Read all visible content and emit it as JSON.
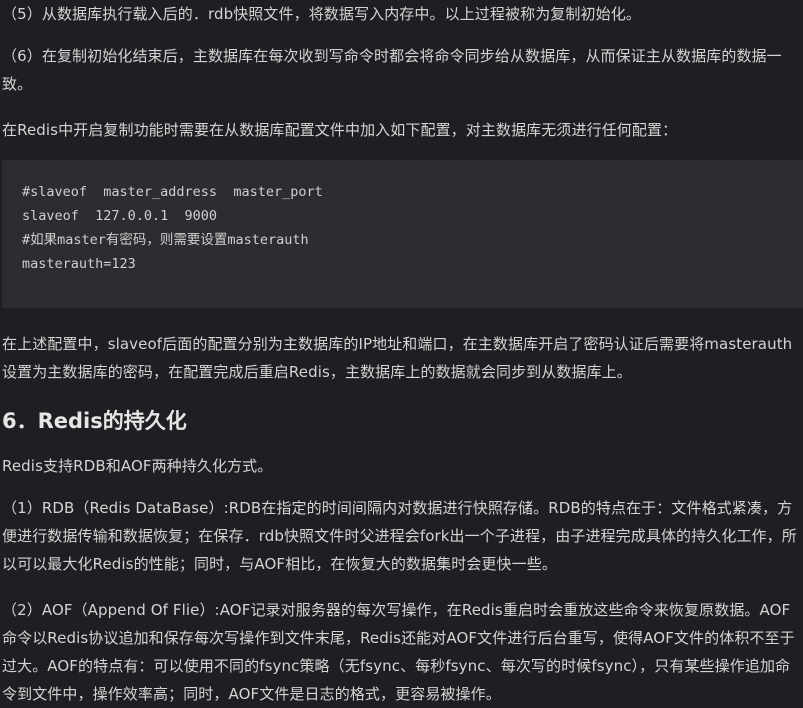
{
  "paragraphs": {
    "p1": "（5）从数据库执行载入后的．rdb快照文件，将数据写入内存中。以上过程被称为复制初始化。",
    "p2": "（6）在复制初始化结束后，主数据库在每次收到写命令时都会将命令同步给从数据库，从而保证主从数据库的数据一致。",
    "p3": "在Redis中开启复制功能时需要在从数据库配置文件中加入如下配置，对主数据库无须进行任何配置：",
    "p4": "在上述配置中，slaveof后面的配置分别为主数据库的IP地址和端口，在主数据库开启了密码认证后需要将masterauth设置为主数据库的密码，在配置完成后重启Redis，主数据库上的数据就会同步到从数据库上。",
    "p5": "Redis支持RDB和AOF两种持久化方式。",
    "p6": "（1）RDB（Redis DataBase）:RDB在指定的时间间隔内对数据进行快照存储。RDB的特点在于：文件格式紧凑，方便进行数据传输和数据恢复；在保存．rdb快照文件时父进程会fork出一个子进程，由子进程完成具体的持久化工作，所以可以最大化Redis的性能；同时，与AOF相比，在恢复大的数据集时会更快一些。",
    "p7": "（2）AOF（Append Of Flie）:AOF记录对服务器的每次写操作，在Redis重启时会重放这些命令来恢复原数据。AOF命令以Redis协议追加和保存每次写操作到文件末尾，Redis还能对AOF文件进行后台重写，使得AOF文件的体积不至于过大。AOF的特点有：可以使用不同的fsync策略（无fsync、每秒fsync、每次写的时候fsync），只有某些操作追加命令到文件中，操作效率高；同时，AOF文件是日志的格式，更容易被操作。"
  },
  "code": {
    "line1": "#slaveof  master_address  master_port",
    "line2": "slaveof  127.0.0.1  9000",
    "line3": "#如果master有密码，则需要设置masterauth",
    "line4": "masterauth=123"
  },
  "heading": "6．Redis的持久化",
  "colors": {
    "background": "#1e1f22",
    "code_background": "#2b2d30",
    "text": "#d4d4d4"
  }
}
